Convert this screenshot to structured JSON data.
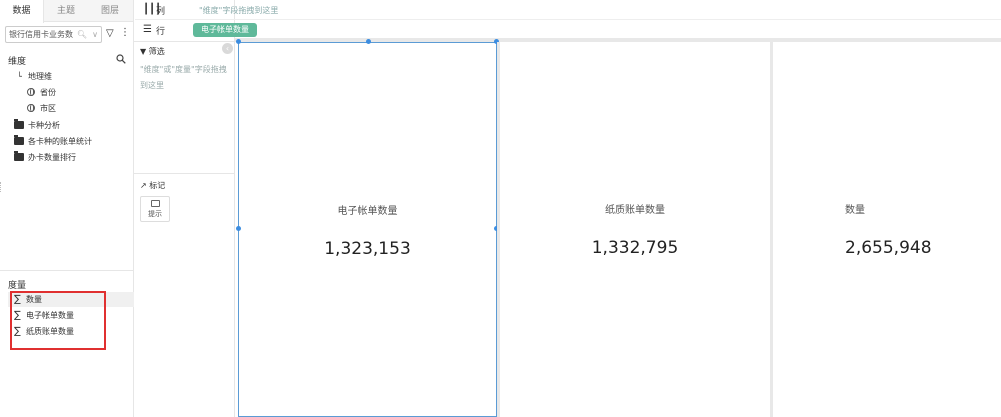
{
  "left_panel": {
    "tabs": [
      "数据",
      "主题",
      "图层"
    ],
    "dataset": "银行信用卡业务数",
    "dimensions_title": "维度",
    "dimensions": {
      "geo": "地理维",
      "geo_children": [
        "省份",
        "市区"
      ],
      "folders": [
        "卡种分析",
        "各卡种的账单统计",
        "办卡数量排行"
      ]
    },
    "measures_title": "度量",
    "measures": [
      "数量",
      "电子帐单数量",
      "纸质账单数量"
    ]
  },
  "middle_panel": {
    "filter_title": "筛选",
    "filter_hint": "\"维度\"或\"度量\"字段拖拽到这里",
    "marks_title": "标记",
    "tip_label": "提示"
  },
  "shelves": {
    "column_label": "列",
    "column_hint": "\"维度\"字段拖拽到这里",
    "row_label": "行",
    "row_pill": "电子帐单数量"
  },
  "cards": [
    {
      "title": "电子帐单数量",
      "value": "1,323,153"
    },
    {
      "title": "纸质账单数量",
      "value": "1,332,795"
    },
    {
      "title": "数量",
      "value": "2,655,948"
    }
  ],
  "colors": {
    "accent": "#5fb99a",
    "selection": "#5b9bd5",
    "highlight": "#e03030"
  }
}
